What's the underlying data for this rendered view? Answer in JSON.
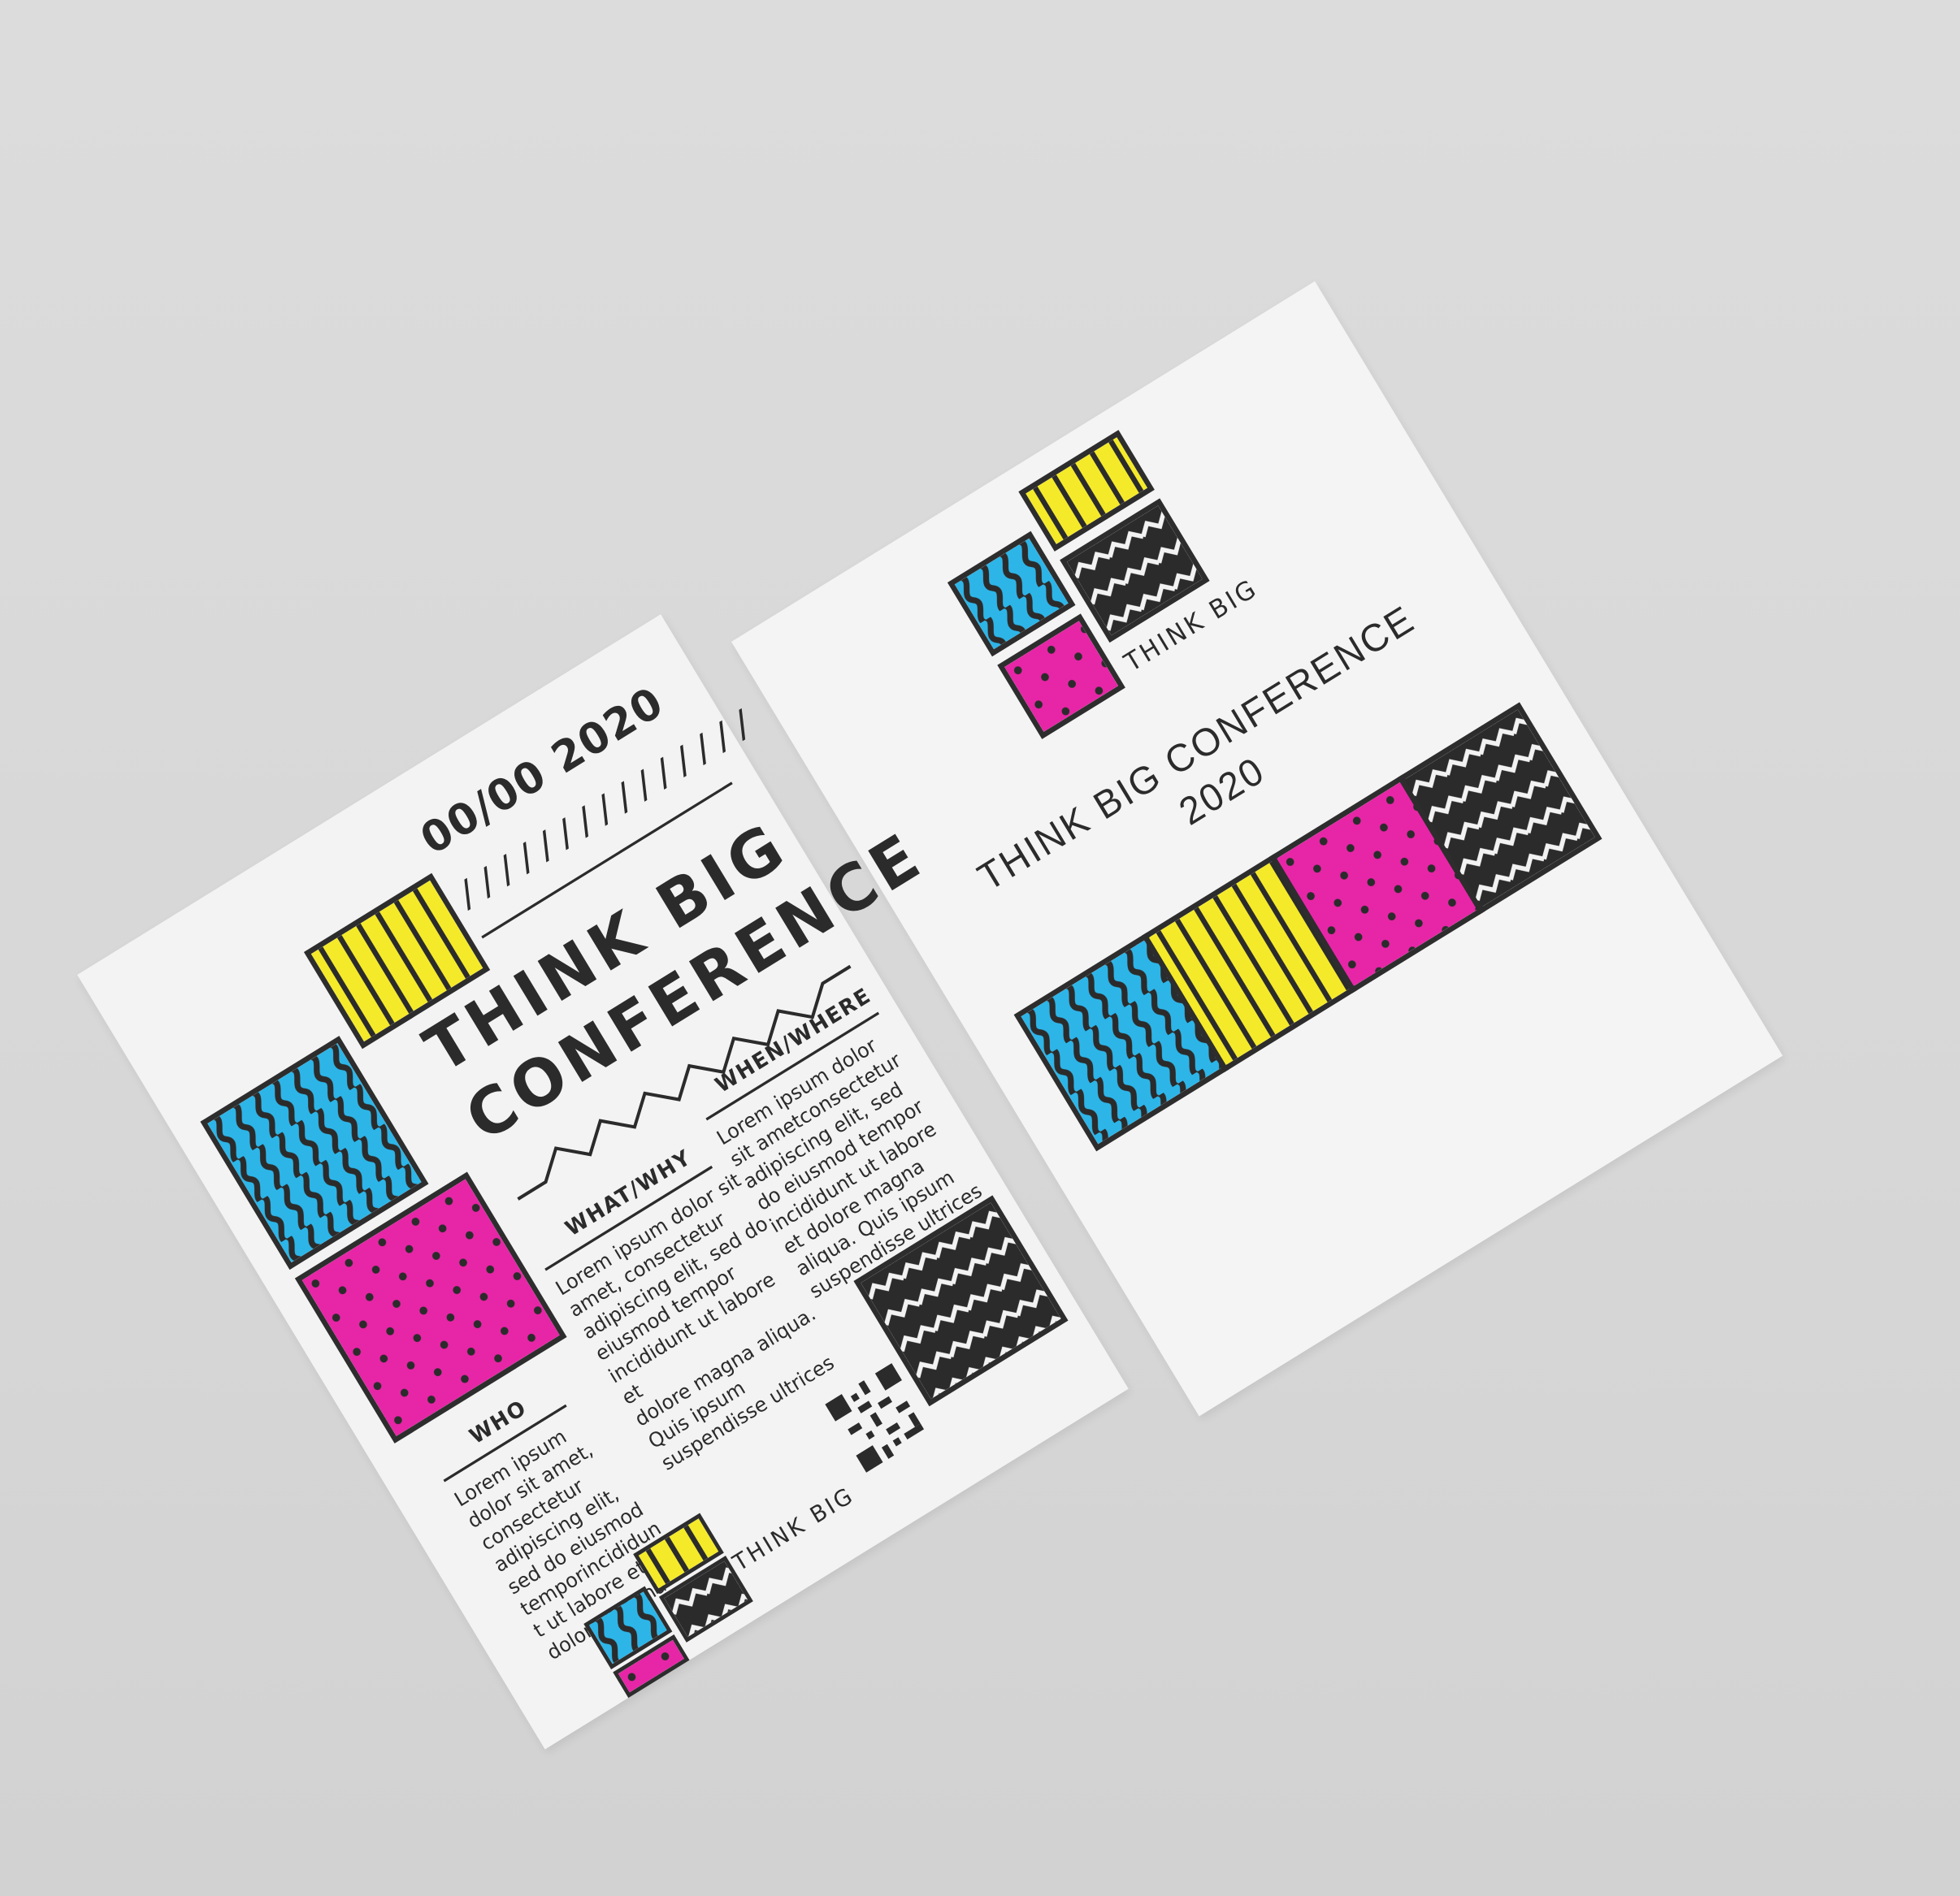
{
  "colors": {
    "background": "#d9d9d9",
    "paper": "#f3f3f3",
    "cyan": "#2db5e8",
    "yellow": "#f4ea2a",
    "magenta": "#e626a6",
    "ink": "#2b2b2b"
  },
  "front": {
    "date": "00/00 2020",
    "slashes": "///////////////",
    "title_line1": "THINK BIG",
    "title_line2": "CONFERENCE",
    "who": {
      "heading": "WHO",
      "body": "Lorem ipsum\ndolor sit amet,\nconsectetur\nadipiscing elit,\nsed do eiusmod\ntemporincididun\nt ut labore et\ndolore magna"
    },
    "whatwhy": {
      "heading": "WHAT/WHY",
      "body": "Lorem ipsum dolor sit\namet, consectetur\nadipiscing elit, sed do\neiusmod tempor\nincididunt ut labore et\ndolore magna aliqua.\nQuis ipsum\nsuspendisse ultrices"
    },
    "whenwhere": {
      "heading": "WHEN/WHERE",
      "body": "Lorem ipsum dolor\nsit ametconsectetur\nadipiscing elit, sed\ndo eiusmod tempor\nincididunt ut labore\net dolore magna\naliqua. Quis ipsum\nsuspendisse ultrices"
    },
    "logo_label": "THINK BIG"
  },
  "back": {
    "logo_label": "THINK BIG",
    "title_line1": "THINK BIG CONFERENCE",
    "title_line2": "2020"
  }
}
